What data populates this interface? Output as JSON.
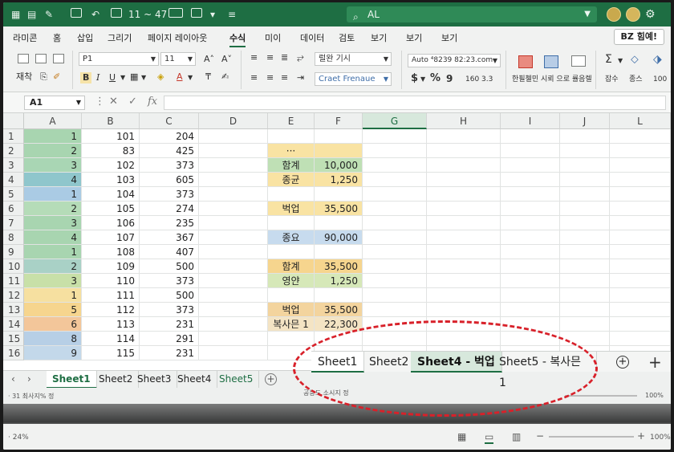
{
  "titlebar": {
    "autosave_text": "11 ~ 47",
    "search_text": "AL",
    "minimize": "—",
    "maximize": "☐",
    "close": "✕"
  },
  "menu": {
    "items": [
      "라미콘",
      "홈",
      "삽입",
      "그리기",
      "페이지 레이아웃",
      "수식",
      "미이",
      "데이터",
      "검토",
      "보기",
      "보기",
      "보기"
    ],
    "active_index": 5,
    "share_label": "BZ 힘예!"
  },
  "ribbon": {
    "paste_label": "재착",
    "font_name": "P1",
    "font_size": "11",
    "bold": "B",
    "italic": "I",
    "underline": "U",
    "font_color_letter": "A",
    "wrap_label": "럴완 기시",
    "merge_label": "Craet Frenaue",
    "number_format": "Auto ⁴8239 82:23.com",
    "currency": "$",
    "percent": "%",
    "comma": "9",
    "decimals": "160 3.3",
    "cond_label": "한필첼민",
    "table_label": "시뢰 으로 률음렐",
    "insert_label": "잡수",
    "delete_label": "종스",
    "format_label": "100"
  },
  "formula_bar": {
    "name_box": "A1",
    "cancel": "✕",
    "enter": "✓",
    "fx": "fx"
  },
  "columns": [
    "A",
    "B",
    "C",
    "D",
    "E",
    "F",
    "G",
    "H",
    "I",
    "J",
    "L"
  ],
  "selected_column": "G",
  "rows": [
    "1",
    "2",
    "3",
    "4",
    "5",
    "6",
    "7",
    "8",
    "9",
    "10",
    "11",
    "12",
    "13",
    "14",
    "15",
    "16"
  ],
  "col_a": [
    "1",
    "2",
    "3",
    "4",
    "1",
    "2",
    "3",
    "4",
    "1",
    "2",
    "3",
    "1",
    "5",
    "6",
    "8",
    "9"
  ],
  "col_a_colors": [
    "#a8d5b0",
    "#a8d5b0",
    "#a9d6b4",
    "#8fc6cc",
    "#aacbe4",
    "#b5dcb8",
    "#a8d5b0",
    "#a8d5b0",
    "#a8d5b0",
    "#a9d1c6",
    "#c8e0a8",
    "#f6e0a0",
    "#f6d58e",
    "#f3c69a",
    "#b7cfe6",
    "#c3d8ea"
  ],
  "col_b": [
    "101",
    "83",
    "102",
    "103",
    "104",
    "105",
    "106",
    "107",
    "108",
    "109",
    "110",
    "111",
    "112",
    "113",
    "114",
    "115"
  ],
  "col_c": [
    "204",
    "425",
    "373",
    "605",
    "373",
    "274",
    "235",
    "367",
    "407",
    "500",
    "373",
    "500",
    "373",
    "231",
    "291",
    "231"
  ],
  "ef_cells": [
    {
      "row": 2,
      "e": "···",
      "f": "",
      "color": "#f9e3a3"
    },
    {
      "row": 3,
      "e": "함계",
      "f": "10,000",
      "color": "#bfe0b5"
    },
    {
      "row": 4,
      "e": "종균",
      "f": "1,250",
      "color": "#f9e3a3"
    },
    {
      "row": 6,
      "e": "벅업",
      "f": "35,500",
      "color": "#f9e3a3"
    },
    {
      "row": 8,
      "e": "종요",
      "f": "90,000",
      "color": "#c7dbee"
    },
    {
      "row": 10,
      "e": "함계",
      "f": "35,500",
      "color": "#f6d58e"
    },
    {
      "row": 11,
      "e": "영얀",
      "f": "1,250",
      "color": "#d6e8b8"
    },
    {
      "row": 13,
      "e": "벅업",
      "f": "35,500",
      "color": "#f3d49e"
    },
    {
      "row": 14,
      "e": "복사믄 1",
      "f": "22,300",
      "color": "#f4e4c4"
    }
  ],
  "sheet_tabs": [
    "Sheet1",
    "Sheet2",
    "Sheet3",
    "Sheet4",
    "Sheet5"
  ],
  "active_sheet_index": 0,
  "zoomed_tabs": [
    "Sheet1",
    "Sheet2",
    "Sheet4 - 벅업",
    "Sheet5 - 복사믄 1"
  ],
  "zoomed_active_index": 2,
  "status": {
    "hint": "공능도 소시지 정",
    "left_small": "· 31 최사지% 정",
    "zoom": "100%",
    "bottom_left": "· 24%",
    "bottom_zoom": "100%"
  },
  "colors": {
    "accent": "#1e6e43",
    "highlight_ring": "#d8212a"
  }
}
